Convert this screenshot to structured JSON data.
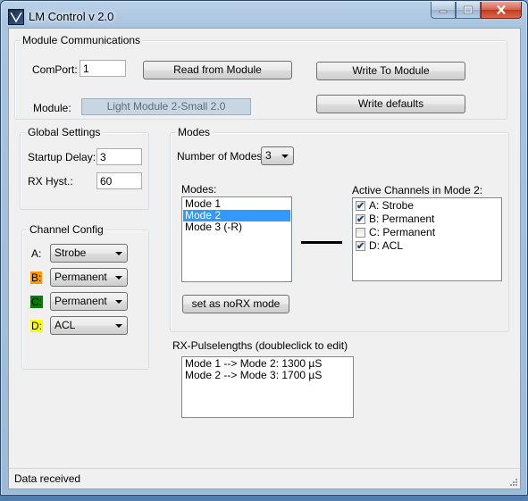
{
  "window": {
    "title": "LM Control v 2.0"
  },
  "module_comm": {
    "title": "Module Communications",
    "comport_label": "ComPort:",
    "comport_value": "1",
    "read_button": "Read from Module",
    "write_button": "Write To Module",
    "module_label": "Module:",
    "module_value": "Light Module 2-Small 2.0",
    "write_defaults_button": "Write defaults"
  },
  "global_settings": {
    "title": "Global Settings",
    "startup_delay_label": "Startup Delay:",
    "startup_delay_value": "3",
    "rx_hyst_label": "RX Hyst.:",
    "rx_hyst_value": "60"
  },
  "channel_config": {
    "title": "Channel Config",
    "channels": [
      {
        "label": "A:",
        "value": "Strobe",
        "color": ""
      },
      {
        "label": "B:",
        "value": "Permanent",
        "color": "#ff9900"
      },
      {
        "label": "C:",
        "value": "Permanent",
        "color": "#008000"
      },
      {
        "label": "D:",
        "value": "ACL",
        "color": "#ffff00"
      }
    ]
  },
  "modes": {
    "title": "Modes",
    "number_label": "Number of Modes:",
    "number_value": "3",
    "list_label": "Modes:",
    "list": [
      "Mode 1",
      "Mode 2",
      "Mode 3 (-R)"
    ],
    "selected_index": 1,
    "active_label": "Active Channels in Mode 2:",
    "active_channels": [
      {
        "label": "A: Strobe",
        "checked": true
      },
      {
        "label": "B: Permanent",
        "checked": true
      },
      {
        "label": "C: Permanent",
        "checked": false
      },
      {
        "label": "D: ACL",
        "checked": true
      }
    ],
    "norx_button": "set as noRX mode"
  },
  "rx_pulse": {
    "title": "RX-Pulselengths (doubleclick to edit)",
    "items": [
      "Mode 1 --> Mode 2: 1300 µS",
      "Mode 2 --> Mode 3: 1700 µS"
    ]
  },
  "status": {
    "text": "Data received"
  },
  "icons": {
    "app": "app-icon",
    "min": "minimize-icon",
    "max": "maximize-icon",
    "close": "close-icon",
    "dropdown": "chevron-down-icon",
    "check": "checkmark-icon",
    "grip": "resize-grip-icon"
  },
  "colors": {
    "selection": "#3399ff",
    "close_button": "#c23a20"
  }
}
